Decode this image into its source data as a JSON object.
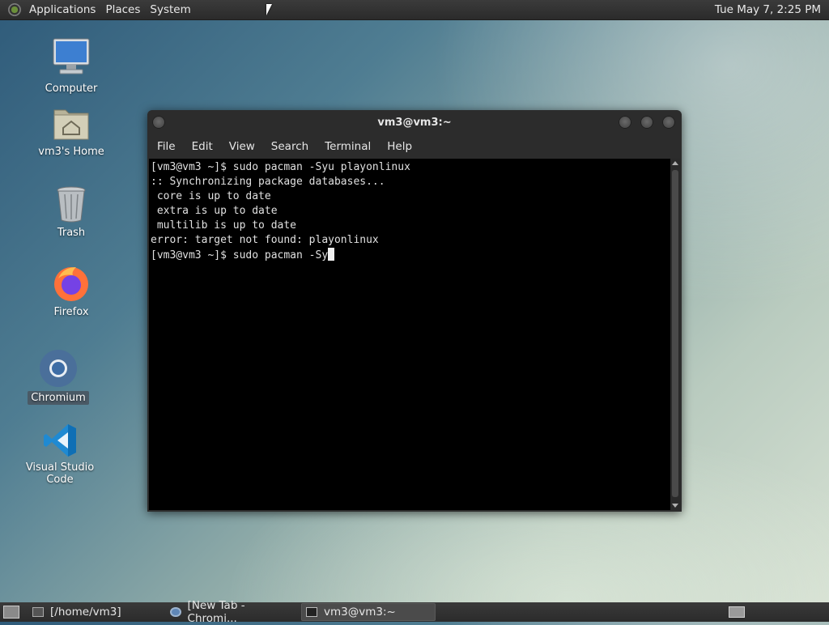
{
  "top_panel": {
    "menus": [
      "Applications",
      "Places",
      "System"
    ],
    "clock": "Tue May 7,  2:25 PM"
  },
  "desktop_icons": [
    {
      "label": "Computer"
    },
    {
      "label": "vm3's Home"
    },
    {
      "label": "Trash"
    },
    {
      "label": "Firefox"
    },
    {
      "label": "Chromium"
    },
    {
      "label": "Visual Studio Code"
    }
  ],
  "terminal": {
    "title": "vm3@vm3:~",
    "menu": [
      "File",
      "Edit",
      "View",
      "Search",
      "Terminal",
      "Help"
    ],
    "lines": [
      "[vm3@vm3 ~]$ sudo pacman -Syu playonlinux",
      ":: Synchronizing package databases...",
      " core is up to date",
      " extra is up to date",
      " multilib is up to date",
      "error: target not found: playonlinux"
    ],
    "prompt": "[vm3@vm3 ~]$ sudo pacman -Sy"
  },
  "taskbar": {
    "tasks": [
      {
        "label": "[/home/vm3]"
      },
      {
        "label": "[New Tab - Chromi..."
      },
      {
        "label": "vm3@vm3:~"
      }
    ]
  },
  "colors": {
    "panel": "#2f2f2f",
    "terminal_bg": "#000000",
    "terminal_fg": "#e0e0e0"
  }
}
